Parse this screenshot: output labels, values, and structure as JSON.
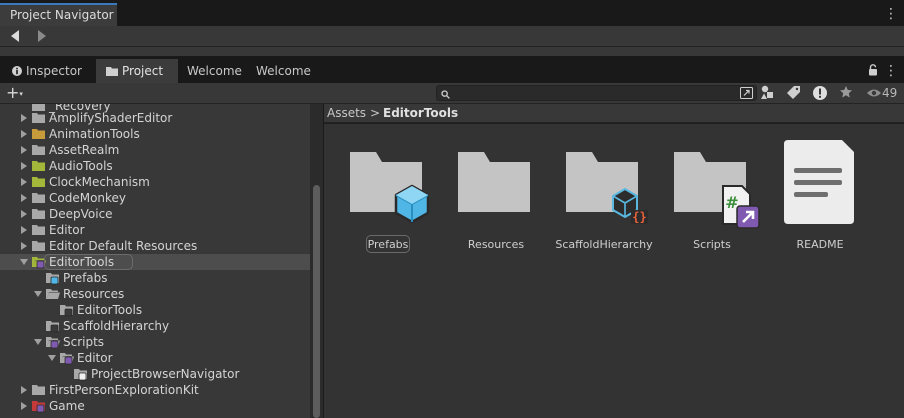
{
  "top_window": {
    "tab_title": "Project Navigator"
  },
  "project_window": {
    "tabs": [
      {
        "label": "Inspector",
        "icon": "info-icon"
      },
      {
        "label": "Project",
        "icon": "folder-icon"
      },
      {
        "label": "Welcome"
      },
      {
        "label": "Welcome"
      }
    ],
    "active_tab": "Project"
  },
  "toolbar": {
    "add_label": "+",
    "search_placeholder": "",
    "hidden_count": "49"
  },
  "tree": [
    {
      "label": "_Recovery",
      "expanded": null,
      "color": "#a8a8a8"
    },
    {
      "label": "AmplifyShaderEditor",
      "expanded": false,
      "color": "#a8a8a8"
    },
    {
      "label": "AnimationTools",
      "expanded": false,
      "color": "#c79a3c"
    },
    {
      "label": "AssetRealm",
      "expanded": false,
      "color": "#a8a8a8"
    },
    {
      "label": "AudioTools",
      "expanded": false,
      "color": "#a3b83a"
    },
    {
      "label": "ClockMechanism",
      "expanded": false,
      "color": "#a3b83a"
    },
    {
      "label": "CodeMonkey",
      "expanded": false,
      "color": "#a8a8a8"
    },
    {
      "label": "DeepVoice",
      "expanded": false,
      "color": "#a8a8a8"
    },
    {
      "label": "Editor",
      "expanded": false,
      "color": "#a8a8a8"
    },
    {
      "label": "Editor Default Resources",
      "expanded": false,
      "color": "#a8a8a8"
    },
    {
      "label": "EditorTools",
      "expanded": true,
      "color": "#a3b83a",
      "selected": true
    },
    {
      "label": "Prefabs",
      "expanded": null,
      "color": "#a8a8a8"
    },
    {
      "label": "Resources",
      "expanded": true,
      "color": "#a8a8a8"
    },
    {
      "label": "EditorTools",
      "expanded": null,
      "color": "#a8a8a8"
    },
    {
      "label": "ScaffoldHierarchy",
      "expanded": null,
      "color": "#a8a8a8"
    },
    {
      "label": "Scripts",
      "expanded": true,
      "color": "#a8a8a8"
    },
    {
      "label": "Editor",
      "expanded": true,
      "color": "#a8a8a8"
    },
    {
      "label": "ProjectBrowserNavigator",
      "expanded": null,
      "color": "#a8a8a8"
    },
    {
      "label": "FirstPersonExplorationKit",
      "expanded": false,
      "color": "#a8a8a8"
    },
    {
      "label": "Game",
      "expanded": false,
      "color": "#c43a3a"
    }
  ],
  "breadcrumb": {
    "root": "Assets",
    "separator": ">",
    "current": "EditorTools"
  },
  "assets": [
    {
      "name": "Prefabs",
      "kind": "folder",
      "badge": "prefab-cube-icon"
    },
    {
      "name": "Resources",
      "kind": "folder",
      "badge": ""
    },
    {
      "name": "ScaffoldHierarchy",
      "kind": "folder",
      "badge": "cube-braces-icon"
    },
    {
      "name": "Scripts",
      "kind": "folder",
      "badge": "csharp-shortcut-icon"
    },
    {
      "name": "README",
      "kind": "document",
      "badge": "document-lines-icon"
    }
  ]
}
